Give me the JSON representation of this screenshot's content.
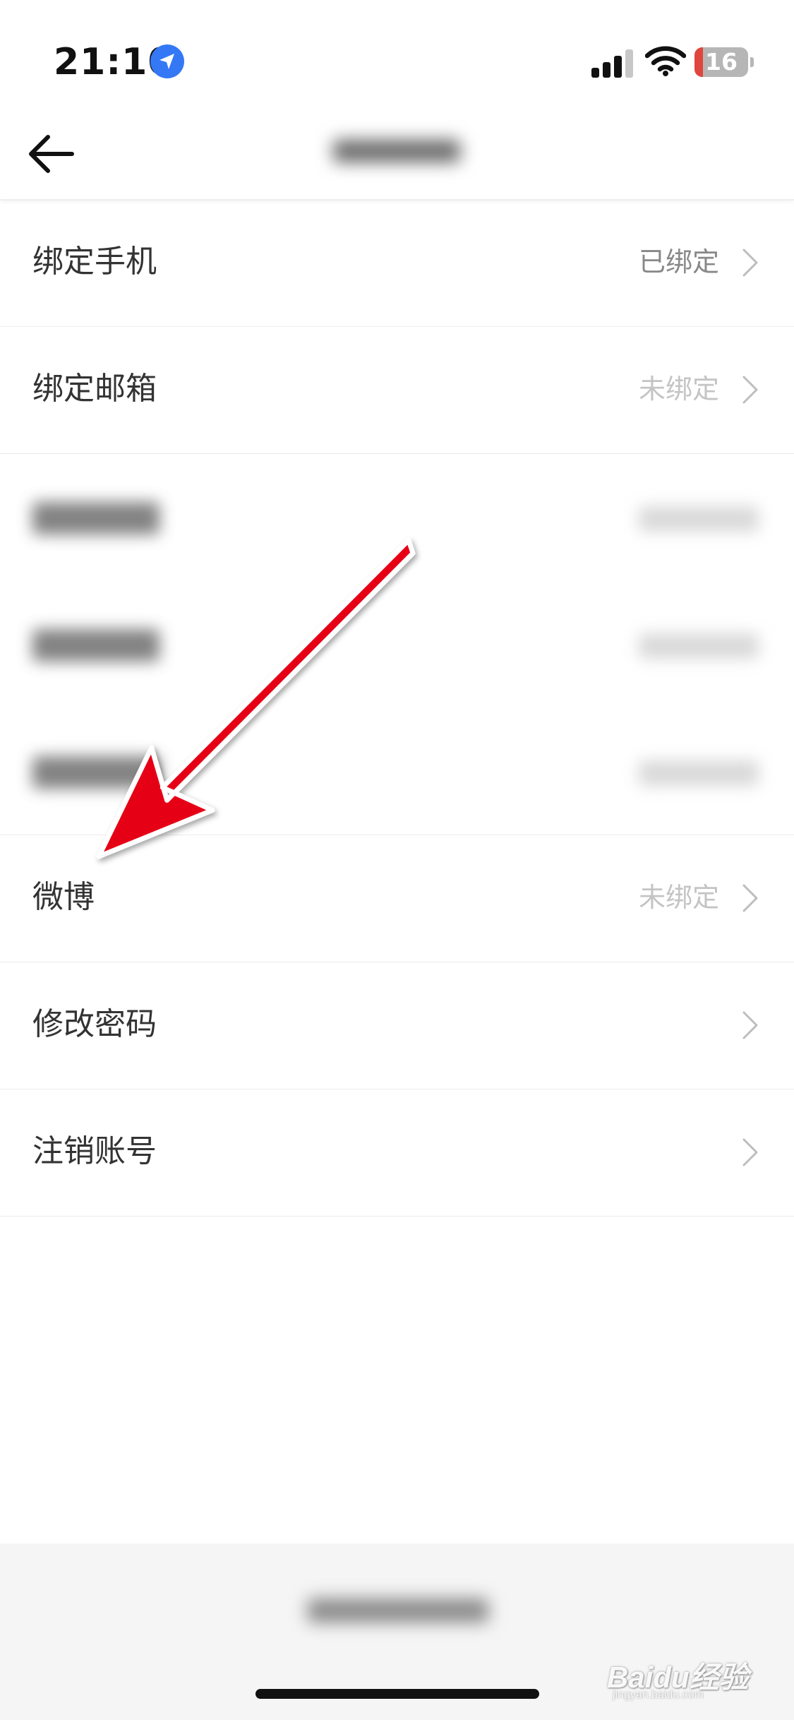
{
  "status_bar": {
    "time": "21:10",
    "battery_level": "16",
    "battery_fraction": 0.16
  },
  "nav": {
    "back_icon": "arrow-left-icon"
  },
  "settings": {
    "bind_phone": {
      "label": "绑定手机",
      "status": "已绑定"
    },
    "bind_email": {
      "label": "绑定邮箱",
      "status": "未绑定"
    },
    "weibo": {
      "label": "微博",
      "status": "未绑定"
    },
    "change_password": {
      "label": "修改密码"
    },
    "delete_account": {
      "label": "注销账号"
    }
  },
  "watermark": {
    "text": "Baidu经验",
    "sub": "jingyan.baidu.com"
  },
  "colors": {
    "annotation_arrow": "#e60012",
    "battery_low": "#e0463d",
    "location_badge": "#3478f6"
  }
}
